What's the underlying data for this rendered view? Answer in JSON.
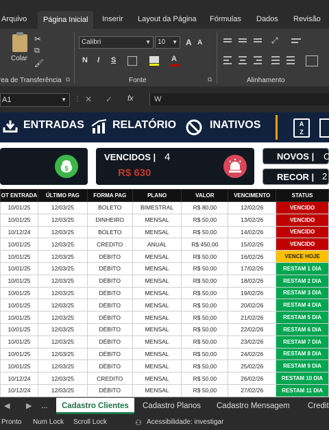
{
  "menu": [
    "Arquivo",
    "Página Inicial",
    "Inserir",
    "Layout da Página",
    "Fórmulas",
    "Dados",
    "Revisão"
  ],
  "ribbon": {
    "paste_label": "Colar",
    "clipboard_label": "rea de Transferência",
    "font_name": "Calibri",
    "font_size": "10",
    "bold": "N",
    "italic": "I",
    "underline": "S",
    "font_label": "Fonte",
    "align_label": "Alinhamento"
  },
  "formula_bar": {
    "name_box": "A1",
    "fx": "fx",
    "value": "W"
  },
  "dashboard": {
    "nav": [
      "ENTRADAS",
      "RELATÓRIO",
      "INATIVOS"
    ],
    "vencidos_label": "VENCIDOS |",
    "vencidos_count": "4",
    "vencidos_value": "R$ 630",
    "novos_label": "NOVOS |",
    "novos_value": "C",
    "recor_label": "RECOR |",
    "recor_value": "2"
  },
  "table": {
    "headers": [
      "OT ENTRADA",
      "ÚLTIMO PAG",
      "FORMA PAG",
      "PLANO",
      "VALOR",
      "VENCIMENTO",
      "STATUS"
    ],
    "rows": [
      [
        "10/01/25",
        "12/03/25",
        "BOLETO",
        "BIMESTRAL",
        "R$ 80,00",
        "12/02/26",
        "VENCIDO"
      ],
      [
        "10/01/25",
        "12/03/25",
        "DINHEIRO",
        "MENSAL",
        "R$ 50,00",
        "13/02/26",
        "VENCIDO"
      ],
      [
        "10/12/24",
        "12/03/25",
        "BOLETO",
        "MENSAL",
        "R$ 50,00",
        "14/02/26",
        "VENCIDO"
      ],
      [
        "10/01/25",
        "12/03/25",
        "CREDITO",
        "ANUAL",
        "R$ 450,00",
        "15/02/26",
        "VENCIDO"
      ],
      [
        "10/01/25",
        "12/03/25",
        "DÉBITO",
        "MENSAL",
        "R$ 50,00",
        "16/02/26",
        "VENCE HOJE"
      ],
      [
        "10/01/25",
        "12/03/25",
        "DÉBITO",
        "MENSAL",
        "R$ 50,00",
        "17/02/26",
        "RESTAM 1 DIA"
      ],
      [
        "10/01/25",
        "12/03/25",
        "DÉBITO",
        "MENSAL",
        "R$ 50,00",
        "18/02/26",
        "RESTAM 2 DIA"
      ],
      [
        "10/01/25",
        "12/03/25",
        "DÉBITO",
        "MENSAL",
        "R$ 50,00",
        "19/02/26",
        "RESTAM 3 DIA"
      ],
      [
        "10/01/25",
        "12/03/25",
        "DÉBITO",
        "MENSAL",
        "R$ 50,00",
        "20/02/26",
        "RESTAM 4 DIA"
      ],
      [
        "10/01/25",
        "12/03/25",
        "DÉBITO",
        "MENSAL",
        "R$ 50,00",
        "21/02/26",
        "RESTAM 5 DIA"
      ],
      [
        "10/01/25",
        "12/03/25",
        "DÉBITO",
        "MENSAL",
        "R$ 50,00",
        "22/02/26",
        "RESTAM 6 DIA"
      ],
      [
        "10/01/25",
        "12/03/25",
        "DÉBITO",
        "MENSAL",
        "R$ 50,00",
        "23/02/26",
        "RESTAM 7 DIA"
      ],
      [
        "10/01/25",
        "12/03/25",
        "DÉBITO",
        "MENSAL",
        "R$ 50,00",
        "24/02/26",
        "RESTAM 8 DIA"
      ],
      [
        "10/01/25",
        "12/03/25",
        "DÉBITO",
        "MENSAL",
        "R$ 50,00",
        "25/02/26",
        "RESTAM 9 DIA"
      ],
      [
        "10/12/24",
        "12/03/25",
        "CREDITO",
        "MENSAL",
        "R$ 50,00",
        "26/02/26",
        "RESTAM 10 DIA"
      ],
      [
        "10/12/24",
        "12/03/25",
        "DÉBITO",
        "MENSAL",
        "R$ 50,00",
        "27/02/26",
        "RESTAM 11 DIA"
      ]
    ],
    "status_colors": {
      "VENCIDO": "#c00000",
      "VENCE HOJE": "#ffc000",
      "RESTAM": "#00a650"
    }
  },
  "sheet_tabs": [
    "...",
    "Cadastro Clientes",
    "Cadastro Planos",
    "Cadastro Mensagem",
    "Credit"
  ],
  "status_bar": [
    "Pronto",
    "Num Lock",
    "Scroll Lock",
    "Acessibilidade: investigar"
  ],
  "colors": {
    "navy": "#10223d",
    "accent": "#f0a500",
    "excel_green": "#1e7145"
  }
}
